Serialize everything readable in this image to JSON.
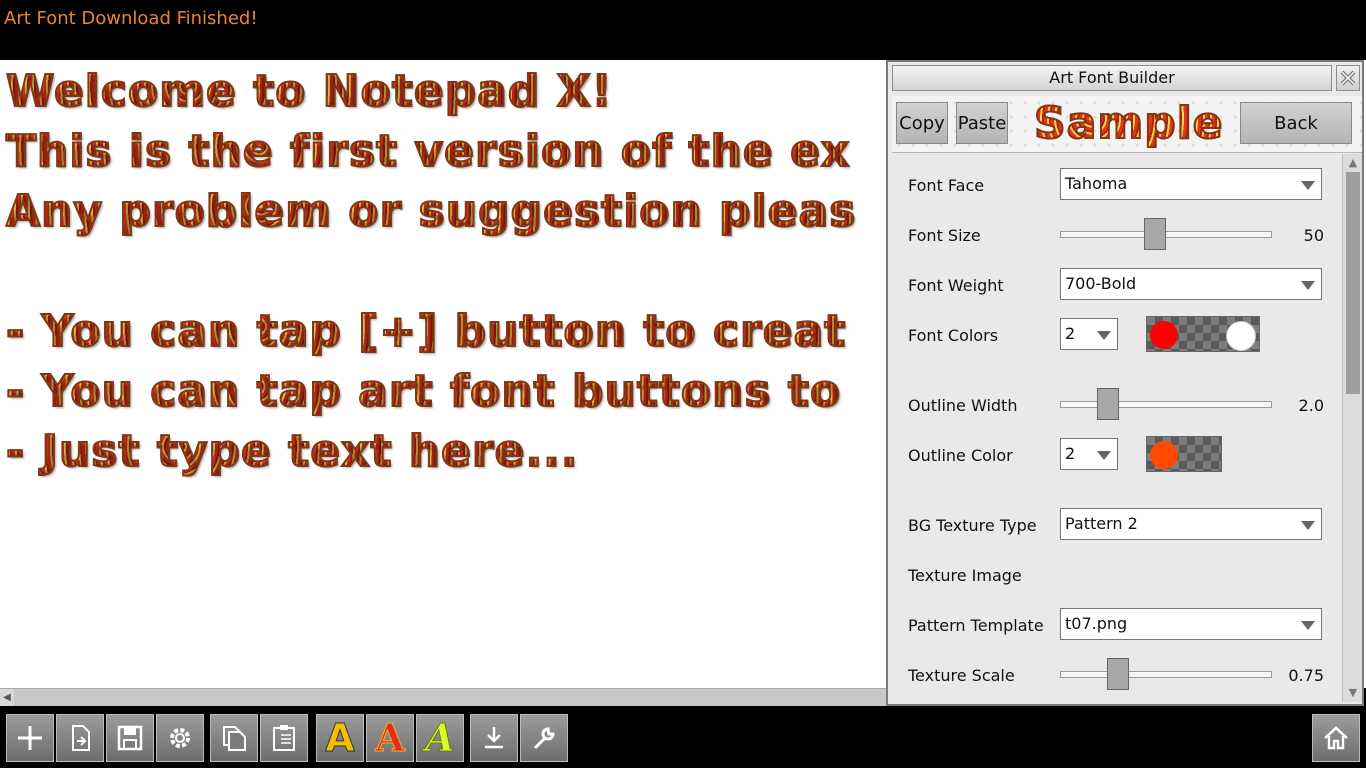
{
  "status": {
    "message": "Art Font Download Finished!"
  },
  "editor": {
    "lines": [
      "Welcome to Notepad X!",
      "This is the first version of the ex",
      "Any problem or suggestion pleas",
      "",
      "- You can tap [+] button to creat",
      "- You can tap art font buttons to",
      "- Just type text here..."
    ]
  },
  "toolbar": {
    "buttons": [
      "new-icon",
      "open-file-icon",
      "save-icon",
      "settings-gear-icon",
      "copy-icon",
      "paste-icon",
      "art-font-a-icon",
      "art-font-a-red-icon",
      "art-font-a-italic-icon",
      "download-icon",
      "wrench-icon",
      "home-icon"
    ],
    "font_a_glyph": "A"
  },
  "panel": {
    "title": "Art Font Builder",
    "copy_label": "Copy",
    "paste_label": "Paste",
    "sample_text": "Sample",
    "back_label": "Back",
    "font_face": {
      "label": "Font Face",
      "value": "Tahoma"
    },
    "font_size": {
      "label": "Font Size",
      "value": "50",
      "level": 0.45
    },
    "font_weight": {
      "label": "Font Weight",
      "value": "700-Bold"
    },
    "font_colors": {
      "label": "Font Colors",
      "count": "2",
      "colors": [
        "#ff0000",
        "#ffffff"
      ]
    },
    "outline_width": {
      "label": "Outline Width",
      "value": "2.0",
      "level": 0.22
    },
    "outline_color": {
      "label": "Outline Color",
      "count": "2",
      "colors": [
        "#ff4a00"
      ]
    },
    "bg_texture_type": {
      "label": "BG Texture Type",
      "value": "Pattern 2"
    },
    "texture_image": {
      "label": "Texture Image"
    },
    "pattern_template": {
      "label": "Pattern Template",
      "value": "t07.png"
    },
    "texture_scale": {
      "label": "Texture Scale",
      "value": "0.75",
      "level": 0.27
    }
  }
}
